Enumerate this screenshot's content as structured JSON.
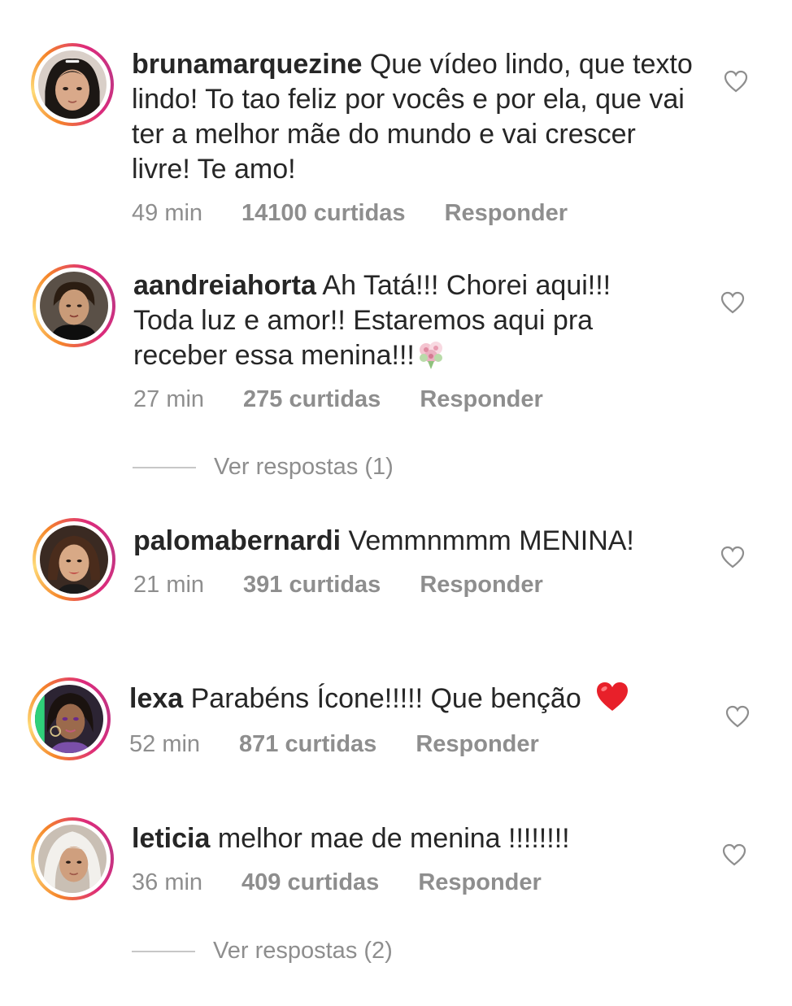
{
  "comments": [
    {
      "username": "brunamarquezine",
      "text": " Que vídeo lindo, que texto lindo! To tao feliz por vocês e por ela, que vai ter a melhor mãe do mundo e vai crescer livre! Te amo!",
      "time": "49 min",
      "likes": "14100 curtidas",
      "reply": "Responder"
    },
    {
      "username": "aandreiahorta",
      "text": " Ah Tatá!!! Chorei aqui!!! Toda luz e amor!! Estaremos aqui pra receber essa menina!!!",
      "emoji": "bouquet",
      "time": "27 min",
      "likes": "275 curtidas",
      "reply": "Responder",
      "view_replies": "Ver respostas (1)"
    },
    {
      "username": "palomabernardi",
      "text": " Vemmnmmm MENINA!",
      "time": "21 min",
      "likes": "391 curtidas",
      "reply": "Responder"
    },
    {
      "username": "lexa",
      "text": " Parabéns Ícone!!!!! Que benção ",
      "emoji": "red-heart",
      "time": "52 min",
      "likes": "871 curtidas",
      "reply": "Responder"
    },
    {
      "username": "leticia",
      "text": " melhor mae de menina !!!!!!!!",
      "time": "36 min",
      "likes": "409 curtidas",
      "reply": "Responder",
      "view_replies": "Ver respostas (2)"
    }
  ],
  "icons": {
    "like": "heart-outline-icon"
  },
  "colors": {
    "text": "#262626",
    "meta": "#8e8e8e",
    "ring_start": "#f58529",
    "ring_end": "#dd2a7b"
  }
}
